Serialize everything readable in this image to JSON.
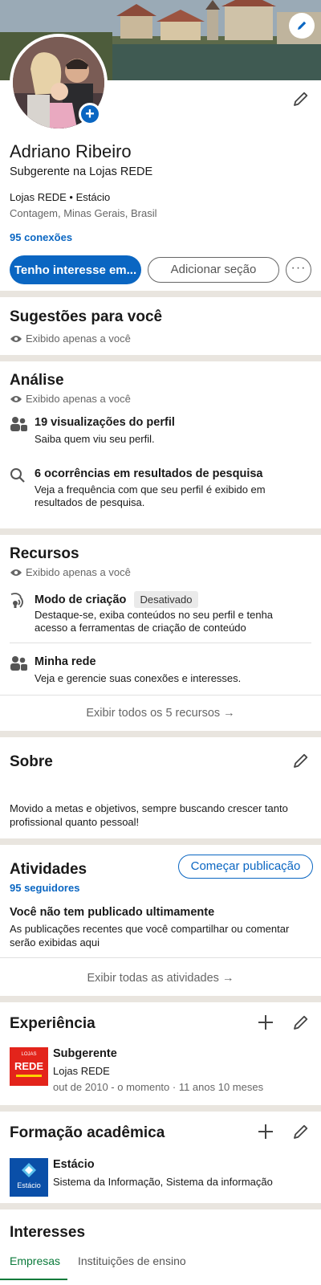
{
  "profile": {
    "name": "Adriano Ribeiro",
    "headline": "Subgerente na Lojas REDE",
    "company_line": "Lojas REDE • Estácio",
    "location": "Contagem, Minas Gerais, Brasil",
    "connections": "95 conexões",
    "primary_button": "Tenho interesse em...",
    "secondary_button": "Adicionar seção",
    "more_button": "···"
  },
  "suggestions": {
    "title": "Sugestões para você",
    "visibility": "Exibido apenas a você"
  },
  "analytics": {
    "title": "Análise",
    "visibility": "Exibido apenas a você",
    "items": [
      {
        "title": "19 visualizações do perfil",
        "sub": "Saiba quem viu seu perfil.",
        "icon": "people-icon"
      },
      {
        "title": "6 ocorrências em resultados de pesquisa",
        "sub": "Veja a frequência com que seu perfil é exibido em resultados de pesquisa.",
        "icon": "search-icon"
      }
    ]
  },
  "resources": {
    "title": "Recursos",
    "visibility": "Exibido apenas a você",
    "items": [
      {
        "title": "Modo de criação",
        "badge": "Desativado",
        "sub": "Destaque-se, exiba conteúdos no seu perfil e tenha acesso a ferramentas de criação de conteúdo",
        "icon": "broadcast-icon"
      },
      {
        "title": "Minha rede",
        "sub": "Veja e gerencie suas conexões e interesses.",
        "icon": "people-icon"
      }
    ],
    "show_all": "Exibir todos os 5 recursos →"
  },
  "about": {
    "title": "Sobre",
    "text": "Movido a metas e objetivos, sempre buscando crescer tanto profissional quanto pessoal!"
  },
  "activity": {
    "title": "Atividades",
    "followers": "95 seguidores",
    "start_post": "Começar publicação",
    "empty_title": "Você não tem publicado ultimamente",
    "empty_text": "As publicações recentes que você compartilhar ou comentar serão exibidas aqui",
    "show_all": "Exibir todas as atividades →"
  },
  "experience": {
    "title": "Experiência",
    "items": [
      {
        "title": "Subgerente",
        "company": "Lojas REDE",
        "period": "out de 2010 - o momento · 11 anos 10 meses",
        "logo_text": "REDE",
        "logo_small": "LOJAS"
      }
    ]
  },
  "education": {
    "title": "Formação acadêmica",
    "items": [
      {
        "school": "Estácio",
        "degree": "Sistema da Informação, Sistema da informação",
        "logo_text": "Estácio"
      }
    ]
  },
  "interests": {
    "title": "Interesses",
    "tabs": [
      "Empresas",
      "Instituições de ensino"
    ]
  },
  "colors": {
    "accent": "#0a66c2",
    "rede_red": "#e3241b",
    "estacio_blue": "#0a4fa8"
  }
}
